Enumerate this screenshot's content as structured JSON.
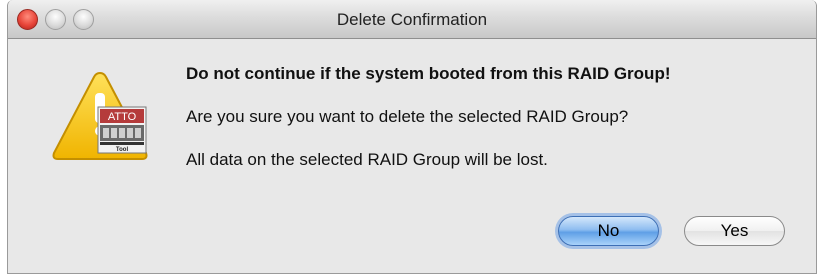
{
  "window": {
    "title": "Delete Confirmation"
  },
  "icons": {
    "alert": "warning-triangle-icon",
    "app_badge": "atto-config-tool-icon"
  },
  "app_badge": {
    "logo_text": "ATTO",
    "caption": "Tool"
  },
  "message": {
    "warning": "Do not continue if the system booted from this RAID Group!",
    "question": "Are you sure you want to delete the selected RAID Group?",
    "info": "All data on the selected RAID Group will be lost."
  },
  "buttons": {
    "no_label": "No",
    "yes_label": "Yes"
  },
  "colors": {
    "close_button": "#e8463a",
    "default_button": "#6fa6e8",
    "warning_triangle": "#f5c20e"
  }
}
